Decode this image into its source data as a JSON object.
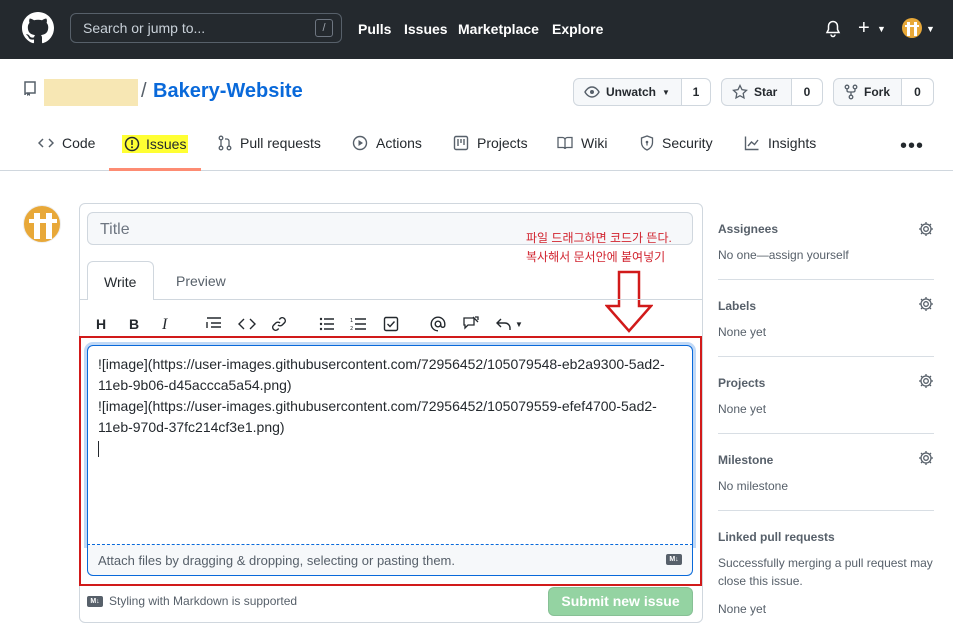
{
  "header": {
    "search_placeholder": "Search or jump to...",
    "search_shortcut": "/",
    "nav": [
      "Pulls",
      "Issues",
      "Marketplace",
      "Explore"
    ]
  },
  "repo": {
    "name": "Bakery-Website",
    "separator": "/",
    "watch": {
      "label": "Unwatch",
      "count": "1"
    },
    "star": {
      "label": "Star",
      "count": "0"
    },
    "fork": {
      "label": "Fork",
      "count": "0"
    }
  },
  "tabs": [
    "Code",
    "Issues",
    "Pull requests",
    "Actions",
    "Projects",
    "Wiki",
    "Security",
    "Insights"
  ],
  "issue_form": {
    "title_placeholder": "Title",
    "write_tab": "Write",
    "preview_tab": "Preview",
    "annotation_line1": "파일 드래그하면  코드가 뜬다.",
    "annotation_line2": "복사해서 문서안에 붙여넣기",
    "body_lines": [
      "![image](https://user-images.githubusercontent.com/72956452/105079548-eb2a9300-5ad2-",
      "11eb-9b06-d45accca5a54.png)",
      "![image](https://user-images.githubusercontent.com/72956452/105079559-efef4700-5ad2-",
      "11eb-970d-37fc214cf3e1.png)"
    ],
    "attach_text": "Attach files by dragging & dropping, selecting or pasting them.",
    "markdown_note": "Styling with Markdown is supported",
    "submit_label": "Submit new issue"
  },
  "sidebar": {
    "assignees": {
      "title": "Assignees",
      "value": "No one—assign yourself"
    },
    "labels": {
      "title": "Labels",
      "value": "None yet"
    },
    "projects": {
      "title": "Projects",
      "value": "None yet"
    },
    "milestone": {
      "title": "Milestone",
      "value": "No milestone"
    },
    "linked": {
      "title": "Linked pull requests",
      "value": "Successfully merging a pull request may close this issue.",
      "value2": "None yet"
    }
  },
  "colors": {
    "header_bg": "#24292e",
    "link": "#0969da",
    "annotation": "#d1242f",
    "submit_disabled": "#94d3a2",
    "highlight": "#ffff33"
  }
}
